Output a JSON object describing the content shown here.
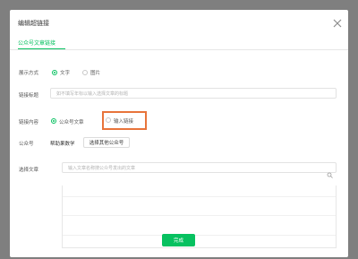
{
  "dialog": {
    "title": "编辑超链接",
    "tab": "公众号文章链接"
  },
  "form": {
    "display_mode": {
      "label": "展示方式",
      "options": [
        "文字",
        "图片"
      ],
      "selected": "文字"
    },
    "link_title": {
      "label": "链接标题",
      "placeholder": "如不填写年标以输入选择文章的标题"
    },
    "link_content": {
      "label": "链接内容",
      "options": [
        "公众号文章",
        "输入链接"
      ],
      "selected": "公众号文章"
    },
    "official_account": {
      "label": "公众号",
      "value": "帮助果数学",
      "button": "选择其他公众号"
    },
    "select_article": {
      "label": "选择文章",
      "placeholder": "输入文章名称搜公众号发出的文章"
    }
  },
  "footer": {
    "done_label": "完成"
  },
  "colors": {
    "accent": "#07c160",
    "highlight": "#e8743b",
    "backdrop": "#7f7f7f"
  },
  "icons": {
    "close": "close-icon",
    "search": "search-icon"
  }
}
